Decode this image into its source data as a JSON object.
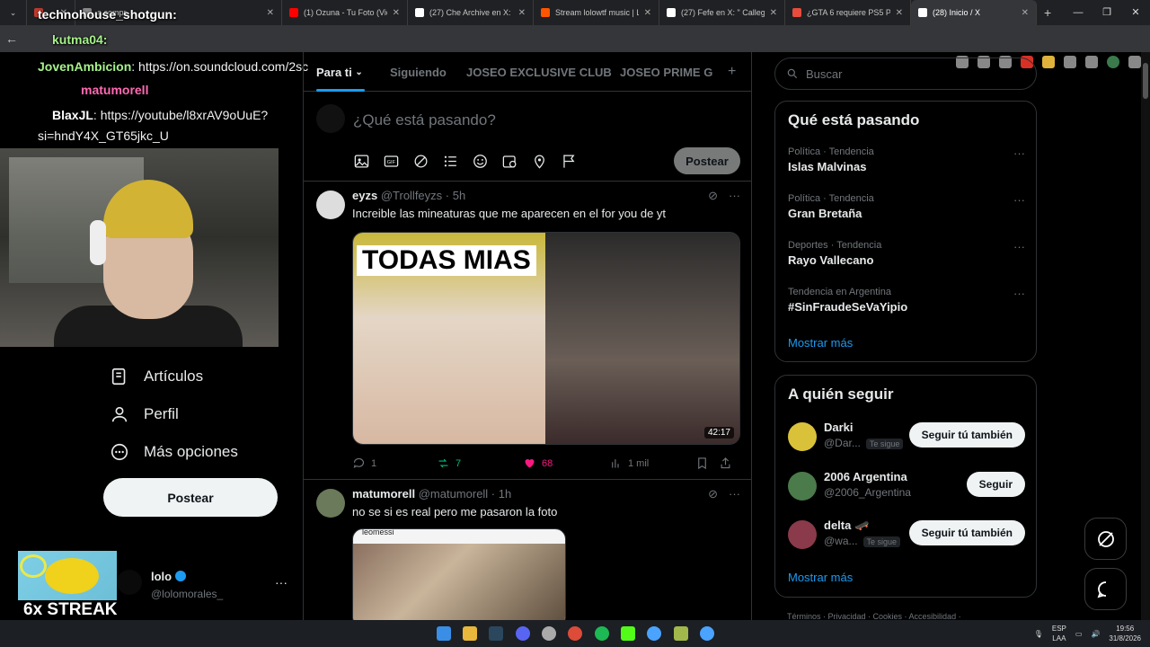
{
  "browser": {
    "tabs": [
      {
        "label": "",
        "fav": "#c0392b"
      },
      {
        "label": "a compr",
        "fav": "#888"
      },
      {
        "label": "(1) Ozuna - Tu Foto (Vide",
        "fav": "#ff0000"
      },
      {
        "label": "(27) Che Archive en X: \"",
        "fav": "#ffffff"
      },
      {
        "label": "Stream lolowtf music | Li",
        "fav": "#ff5500"
      },
      {
        "label": "(27) Fefe en X: \" Calleg",
        "fav": "#ffffff"
      },
      {
        "label": "¿GTA 6 requiere PS5 Pro",
        "fav": "#e74c3c"
      },
      {
        "label": "(28) Inicio / X",
        "fav": "#ffffff"
      }
    ],
    "new_tab": "+"
  },
  "overlay": {
    "chat": [
      {
        "user": "technohouse_shotgun:",
        "msg": ""
      },
      {
        "user": "kutma04:",
        "msg": ""
      },
      {
        "user": "JovenAmbicion",
        "msg": ": https://on.soundcloud.com/2sc"
      },
      {
        "user": "matumorell",
        "msg": ":"
      },
      {
        "user": "BlaxJL",
        "msg": ": https://youtube/l8xrAV9oUuE?"
      },
      {
        "user": "",
        "msg": "si=hndY4X_GT65jkc_U"
      }
    ],
    "streak": "6x STREAK"
  },
  "nav": {
    "items": [
      {
        "label": "Artículos",
        "icon": "articles-icon"
      },
      {
        "label": "Perfil",
        "icon": "profile-icon"
      },
      {
        "label": "Más opciones",
        "icon": "more-options-icon"
      }
    ],
    "post_button": "Postear",
    "profile": {
      "name": "lolo",
      "handle": "@lolomorales_"
    }
  },
  "feed": {
    "tabs": [
      "Para ti",
      "Siguiendo",
      "JOSEO EXCLUSIVE CLUB",
      "JOSEO PRIME GR"
    ],
    "compose": {
      "placeholder": "¿Qué está pasando?",
      "post_button": "Postear"
    },
    "tweets": [
      {
        "name": "eyzs",
        "meta": "@Trollfeyzs · 5h",
        "text": "Increible las mineaturas que me aparecen en el for you de yt",
        "media_caption": "TODAS MIAS",
        "duration": "42:17",
        "replies": "1",
        "retweets": "7",
        "likes": "68",
        "views": "1 mil"
      },
      {
        "name": "matumorell",
        "meta": "@matumorell · 1h",
        "text": "no se si es real pero me pasaron la foto",
        "media_caption": "leomessi"
      }
    ]
  },
  "sidebar": {
    "search_placeholder": "Buscar",
    "trends_title": "Qué está pasando",
    "trends": [
      {
        "meta": "Política · Tendencia",
        "name": "Islas Malvinas"
      },
      {
        "meta": "Política · Tendencia",
        "name": "Gran Bretaña"
      },
      {
        "meta": "Deportes · Tendencia",
        "name": "Rayo Vallecano"
      },
      {
        "meta": "Tendencia en Argentina",
        "name": "#SinFraudeSeVaYipio"
      }
    ],
    "show_more": "Mostrar más",
    "who_title": "A quién seguir",
    "who": [
      {
        "name": "Darki",
        "handle": "@Dar...",
        "tag": "Te sigue",
        "button": "Seguir tú también",
        "color": "#d9c23a"
      },
      {
        "name": "2006 Argentina",
        "handle": "@2006_Argentina",
        "tag": "",
        "button": "Seguir",
        "color": "#4b7a4b"
      },
      {
        "name": "delta 🛹",
        "handle": "@wa...",
        "tag": "Te sigue",
        "button": "Seguir tú también",
        "color": "#8a3a4a"
      }
    ],
    "footer": "Términos · Privacidad · Cookies · Accesibilidad ·"
  },
  "taskbar": {
    "lang": "ESP\nLAA",
    "time": "19:56",
    "date": "31/8/2026"
  },
  "colors": {
    "accent": "#1d9bf0",
    "retweet": "#00ba7c",
    "like": "#f91880"
  }
}
